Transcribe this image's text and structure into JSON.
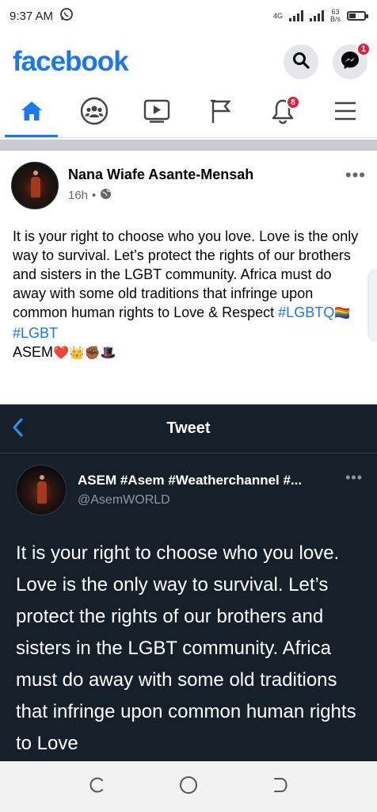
{
  "status_bar": {
    "time": "9:37 AM",
    "network_label": "4G",
    "speed_value": "63",
    "speed_unit": "B/s"
  },
  "header": {
    "logo": "facebook",
    "messenger_badge": "1"
  },
  "nav": {
    "notifications_badge": "8"
  },
  "post": {
    "author": "Nana Wiafe Asante-Mensah",
    "time": "16h",
    "separator": "•",
    "text_main": "It is your right to choose who you love. Love is the only way to survival. Let’s protect the rights of our brothers and sisters in the LGBT community. Africa must do away with some old traditions that infringe upon common human rights to Love & Respect ",
    "hashtag_1": "#LGBTQ",
    "hashtag_1_emoji": "🏳️‍🌈",
    "hashtag_2": "#LGBT",
    "signoff": "ASEM",
    "signoff_emojis": "❤️👑✊🏾🎩"
  },
  "tweet": {
    "title": "Tweet",
    "display_name": "ASEM #Asem #Weatherchannel #...",
    "handle": "@AsemWORLD",
    "text": "It is your right to choose who you love. Love is the only way to survival. Let’s protect the rights of our brothers and sisters in the LGBT community. Africa must do away with some old traditions that infringe upon common human rights to Love"
  },
  "colors": {
    "facebook_blue": "#1877f2",
    "twitter_bg": "#15202b",
    "twitter_blue": "#1d9bf0",
    "badge_red": "#e41e3f"
  },
  "icons": [
    "whatsapp-icon",
    "search-icon",
    "messenger-icon",
    "home-icon",
    "groups-icon",
    "watch-icon",
    "pages-flag-icon",
    "bell-icon",
    "menu-icon",
    "globe-icon",
    "back-chevron-icon",
    "recents-icon",
    "home-circle-icon",
    "back-icon"
  ]
}
